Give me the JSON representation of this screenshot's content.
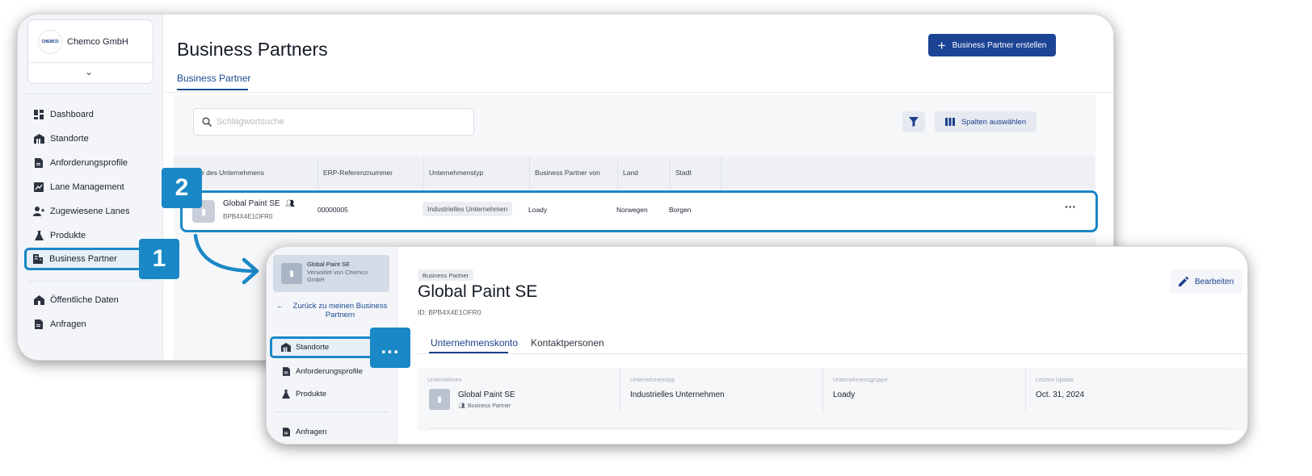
{
  "brand": {
    "accent": "#1a88c6",
    "primary": "#1c4494"
  },
  "list_window": {
    "company": {
      "logo_text": "CHEMCO",
      "name": "Chemco GmbH"
    },
    "nav": [
      {
        "label": "Dashboard",
        "icon": "dashboard-icon"
      },
      {
        "label": "Standorte",
        "icon": "warehouse-icon"
      },
      {
        "label": "Anforderungsprofile",
        "icon": "document-icon"
      },
      {
        "label": "Lane Management",
        "icon": "chart-icon"
      },
      {
        "label": "Zugewiesene Lanes",
        "icon": "person-add-icon"
      },
      {
        "label": "Produkte",
        "icon": "flask-icon"
      },
      {
        "label": "Business Partner",
        "icon": "building-icon",
        "active": true
      }
    ],
    "nav_secondary": [
      {
        "label": "Öffentliche Daten",
        "icon": "house-icon"
      },
      {
        "label": "Anfragen",
        "icon": "document-icon"
      }
    ],
    "title": "Business Partners",
    "tab": "Business Partner",
    "create_button": "Business Partner erstellen",
    "search_placeholder": "Schlagwortsuche",
    "columns_button": "Spalten auswählen",
    "columns": [
      "me des Unternehmens",
      "ERP-Referenznummer",
      "Unternehmenstyp",
      "Business Partner von",
      "Land",
      "Stadt"
    ],
    "row": {
      "name": "Global Paint SE",
      "id": "BPB4X4E1OFR0",
      "erp": "00000005",
      "type": "Industrielles Unternehmen",
      "partner_of": "Loady",
      "country": "Norwegen",
      "city": "Borgen"
    }
  },
  "badges": {
    "one": "1",
    "two": "2",
    "more": "..."
  },
  "detail_window": {
    "context": {
      "name": "Global Paint SE",
      "managed_by": "Verwaltet von Chemco GmbH"
    },
    "back_link": "Zurück zu meinen Business Partnern",
    "nav": [
      {
        "label": "Standorte",
        "icon": "warehouse-icon",
        "active": true
      },
      {
        "label": "Anforderungsprofile",
        "icon": "document-icon"
      },
      {
        "label": "Produkte",
        "icon": "flask-icon"
      }
    ],
    "nav_secondary": [
      {
        "label": "Anfragen",
        "icon": "document-icon"
      }
    ],
    "chip": "Business Partner",
    "title": "Global Paint SE",
    "id_line": "ID: BPB4X4E1OFR0",
    "edit_button": "Bearbeiten",
    "tabs": [
      "Unternehmenskonto",
      "Kontaktpersonen"
    ],
    "info": {
      "company_label": "Unternehmen",
      "company_name": "Global Paint SE",
      "company_sub": "Business Partner",
      "type_label": "Unternehmenstyp",
      "type_value": "Industrielles Unternehmen",
      "group_label": "Unternehmensgruppe",
      "group_value": "Loady",
      "update_label": "Letztes Update",
      "update_value": "Oct. 31, 2024"
    }
  }
}
